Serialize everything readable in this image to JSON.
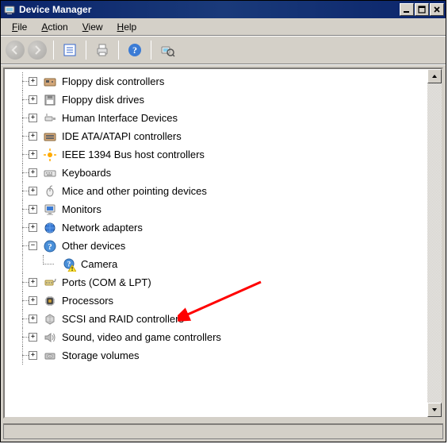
{
  "window": {
    "title": "Device Manager"
  },
  "menu": {
    "file": "File",
    "action": "Action",
    "view": "View",
    "help": "Help"
  },
  "tree": {
    "items": [
      {
        "label": "Floppy disk controllers",
        "icon": "floppy-controller",
        "toggle": "+",
        "expanded": false
      },
      {
        "label": "Floppy disk drives",
        "icon": "floppy-drive",
        "toggle": "+",
        "expanded": false
      },
      {
        "label": "Human Interface Devices",
        "icon": "hid",
        "toggle": "+",
        "expanded": false
      },
      {
        "label": "IDE ATA/ATAPI controllers",
        "icon": "ide",
        "toggle": "+",
        "expanded": false
      },
      {
        "label": "IEEE 1394 Bus host controllers",
        "icon": "ieee1394",
        "toggle": "+",
        "expanded": false
      },
      {
        "label": "Keyboards",
        "icon": "keyboard",
        "toggle": "+",
        "expanded": false
      },
      {
        "label": "Mice and other pointing devices",
        "icon": "mouse",
        "toggle": "+",
        "expanded": false
      },
      {
        "label": "Monitors",
        "icon": "monitor",
        "toggle": "+",
        "expanded": false
      },
      {
        "label": "Network adapters",
        "icon": "network",
        "toggle": "+",
        "expanded": false
      },
      {
        "label": "Other devices",
        "icon": "unknown",
        "toggle": "−",
        "expanded": true
      },
      {
        "label": " Camera",
        "icon": "unknown-warning",
        "parent": 9,
        "highlighted": true
      },
      {
        "label": "Ports (COM & LPT)",
        "icon": "ports",
        "toggle": "+",
        "expanded": false
      },
      {
        "label": "Processors",
        "icon": "processor",
        "toggle": "+",
        "expanded": false
      },
      {
        "label": "SCSI and RAID controllers",
        "icon": "scsi",
        "toggle": "+",
        "expanded": false
      },
      {
        "label": "Sound, video and game controllers",
        "icon": "sound",
        "toggle": "+",
        "expanded": false
      },
      {
        "label": "Storage volumes",
        "icon": "storage",
        "toggle": "+",
        "expanded": false
      }
    ]
  }
}
